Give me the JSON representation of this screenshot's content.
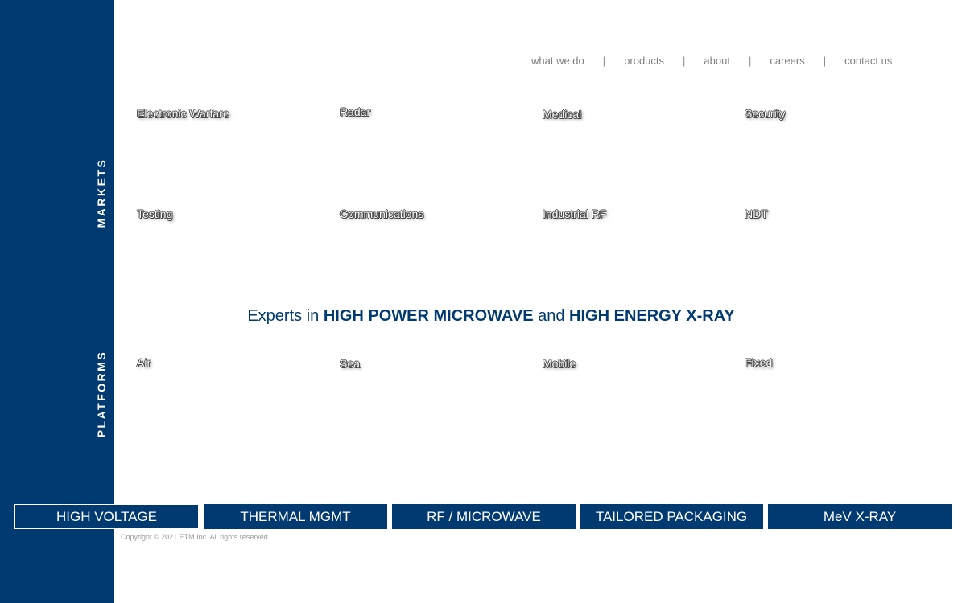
{
  "nav": {
    "items": [
      "what we do",
      "products",
      "about",
      "careers",
      "contact us"
    ],
    "separator": "|"
  },
  "sidebar": {
    "markets_label": "MARKETS",
    "platforms_label": "PLATFORMS"
  },
  "markets": {
    "row1": [
      "Electronic Warfare",
      "Radar",
      "Medical",
      "Security"
    ],
    "row2": [
      "Testing",
      "Communications",
      "Industrial RF",
      "NDT"
    ]
  },
  "tagline": {
    "part1": "Experts in ",
    "part2": "HIGH POWER MICROWAVE",
    "part3": " and ",
    "part4": "HIGH ENERGY X-RAY"
  },
  "platforms": [
    "Air",
    "Sea",
    "Mobile",
    "Fixed"
  ],
  "product_bar": [
    "HIGH VOLTAGE",
    "THERMAL MGMT",
    "RF / MICROWAVE",
    "TAILORED PACKAGING",
    "MeV X-RAY"
  ],
  "copyright": "Copyright © 2021 ETM Inc. All rights reserved.",
  "colors": {
    "brand_navy": "#003a70",
    "nav_gray": "#7f7f7f"
  }
}
